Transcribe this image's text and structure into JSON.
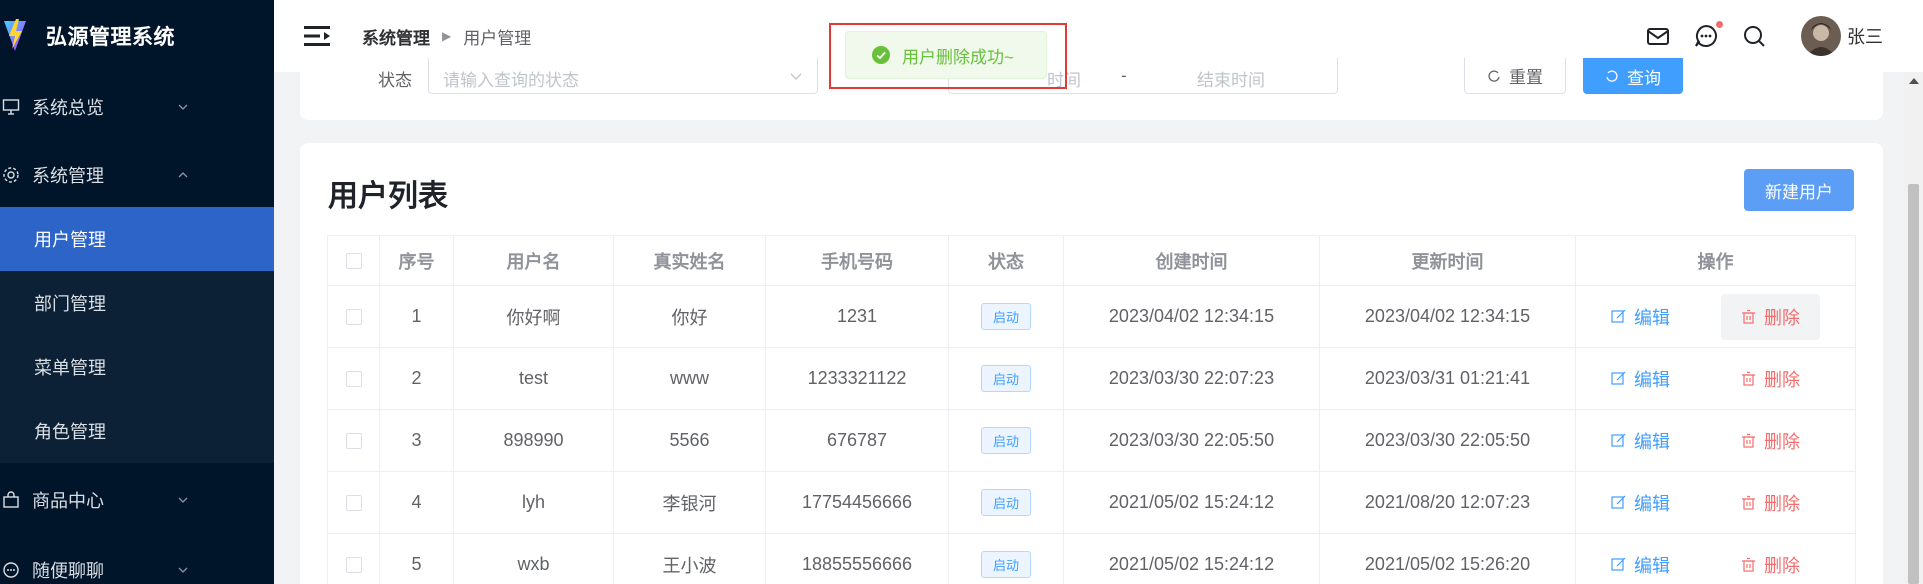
{
  "sidebar": {
    "brand": "弘源管理系统",
    "items": [
      {
        "label": "系统总览",
        "icon": "monitor-icon"
      },
      {
        "label": "系统管理",
        "icon": "gear-icon"
      },
      {
        "label": "商品中心",
        "icon": "shopping-bag-icon"
      },
      {
        "label": "随便聊聊",
        "icon": "chat-icon"
      }
    ],
    "subitems": [
      {
        "label": "用户管理",
        "active": true
      },
      {
        "label": "部门管理",
        "active": false
      },
      {
        "label": "菜单管理",
        "active": false
      },
      {
        "label": "角色管理",
        "active": false
      }
    ]
  },
  "header": {
    "breadcrumb": [
      "系统管理",
      "用户管理"
    ],
    "username": "张三"
  },
  "search": {
    "status_label": "状态",
    "status_placeholder": "请输入查询的状态",
    "start_placeholder": "时间",
    "range_sep": "-",
    "end_placeholder": "结束时间",
    "reset_label": "重置",
    "query_label": "查询"
  },
  "toast": {
    "message": "用户删除成功~"
  },
  "table": {
    "title": "用户列表",
    "new_button": "新建用户",
    "columns": [
      "序号",
      "用户名",
      "真实姓名",
      "手机号码",
      "状态",
      "创建时间",
      "更新时间",
      "操作"
    ],
    "edit_label": "编辑",
    "delete_label": "删除",
    "rows": [
      {
        "index": "1",
        "username": "你好啊",
        "realname": "你好",
        "phone": "1231",
        "status": "启动",
        "created": "2023/04/02 12:34:15",
        "updated": "2023/04/02 12:34:15"
      },
      {
        "index": "2",
        "username": "test",
        "realname": "www",
        "phone": "1233321122",
        "status": "启动",
        "created": "2023/03/30 22:07:23",
        "updated": "2023/03/31 01:21:41"
      },
      {
        "index": "3",
        "username": "898990",
        "realname": "5566",
        "phone": "676787",
        "status": "启动",
        "created": "2023/03/30 22:05:50",
        "updated": "2023/03/30 22:05:50"
      },
      {
        "index": "4",
        "username": "lyh",
        "realname": "李银河",
        "phone": "17754456666",
        "status": "启动",
        "created": "2021/05/02 15:24:12",
        "updated": "2021/08/20 12:07:23"
      },
      {
        "index": "5",
        "username": "wxb",
        "realname": "王小波",
        "phone": "18855556666",
        "status": "启动",
        "created": "2021/05/02 15:24:12",
        "updated": "2021/05/02 15:26:20"
      }
    ]
  },
  "colors": {
    "sidebar_bg": "#001529",
    "active_item": "#2d64c8",
    "primary": "#409eff",
    "danger": "#f56c6c",
    "success": "#67c23a"
  }
}
